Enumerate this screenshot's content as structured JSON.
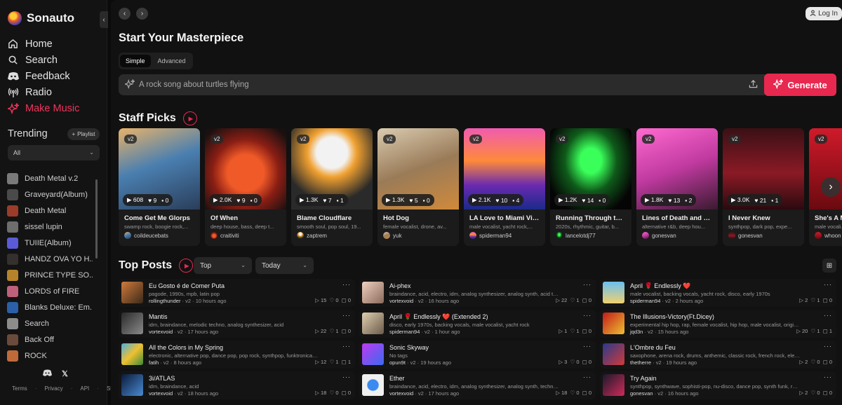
{
  "app": {
    "name": "Sonauto"
  },
  "nav": [
    {
      "label": "Home",
      "icon": "home-icon"
    },
    {
      "label": "Search",
      "icon": "search-icon"
    },
    {
      "label": "Feedback",
      "icon": "discord-icon"
    },
    {
      "label": "Radio",
      "icon": "radio-icon"
    },
    {
      "label": "Make Music",
      "icon": "sparkle-icon",
      "active": true
    }
  ],
  "trending": {
    "title": "Trending",
    "playlist_button": "Playlist",
    "filter": "All",
    "items": [
      {
        "label": "Death Metal v.2",
        "color": "#7a7a7a"
      },
      {
        "label": "Graveyard(Album)",
        "color": "#4a4a4a"
      },
      {
        "label": "Death Metal",
        "color": "#9b3b2a"
      },
      {
        "label": "sissel lupin",
        "color": "#6d6d6d"
      },
      {
        "label": "TUIIE(Album)",
        "color": "#5b5bd8"
      },
      {
        "label": "HANDZ OVA YO H...",
        "color": "#33302d"
      },
      {
        "label": "PRINCE TYPE SO...",
        "color": "#b5842a"
      },
      {
        "label": "LORDS of FIRE",
        "color": "#c0607a"
      },
      {
        "label": "Blanks Deluxe: Em...",
        "color": "#2b5fa8"
      },
      {
        "label": "Search",
        "color": "#8c8c8c"
      },
      {
        "label": "Back Off",
        "color": "#6a4a3a"
      },
      {
        "label": "ROCK",
        "color": "#c06a3a"
      }
    ]
  },
  "footer": {
    "links": [
      "Terms",
      "Privacy",
      "API",
      "Status"
    ]
  },
  "header": {
    "login": "Log In"
  },
  "create": {
    "title": "Start Your Masterpiece",
    "tabs": [
      "Simple",
      "Advanced"
    ],
    "prompt_placeholder": "A rock song about turtles flying",
    "generate": "Generate"
  },
  "staff_picks": {
    "title": "Staff Picks",
    "cards": [
      {
        "version": "v2",
        "plays": "608",
        "likes": "9",
        "comments": "0",
        "title": "Come Get Me Glorps",
        "tags": "swamp rock, boogie rock,...",
        "user": "coildeucebats",
        "art": "linear-gradient(160deg,#e8b36a 0%,#4a7fb0 45%,#2a3d5a 100%)"
      },
      {
        "version": "v2",
        "plays": "2.0K",
        "likes": "9",
        "comments": "0",
        "title": "Of When",
        "tags": "deep house, bass, deep t...",
        "user": "craitiviti",
        "art": "radial-gradient(circle at 50% 55%,#f05a28 0 30%,#8a1e14 55%,#1a1010 90%)"
      },
      {
        "version": "v2",
        "plays": "1.3K",
        "likes": "7",
        "comments": "1",
        "title": "Blame Cloudflare",
        "tags": "smooth soul, pop soul, 19...",
        "user": "zaptrem",
        "art": "radial-gradient(circle at 50% 30%,#f2f2f2 0 22%,#f0a030 35%,#2a2a2a 70%)"
      },
      {
        "version": "v2",
        "plays": "1.3K",
        "likes": "5",
        "comments": "0",
        "title": "Hot Dog",
        "tags": "female vocalist, drone, av...",
        "user": "yuk",
        "art": "linear-gradient(160deg,#d9cbb0 0%,#9a7b58 50%,#d08a3a 100%)"
      },
      {
        "version": "v2",
        "plays": "2.1K",
        "likes": "10",
        "comments": "4",
        "title": "LA Love to Miami Vic...",
        "tags": "male vocalist, yacht rock,...",
        "user": "spiderman94",
        "art": "linear-gradient(180deg,#f05bb0 0%,#ff8a3a 40%,#6a2ab0 70%,#1a2a8a 100%)"
      },
      {
        "version": "v2",
        "plays": "1.2K",
        "likes": "14",
        "comments": "0",
        "title": "Running Through the...",
        "tags": "2020s, rhythmic, guitar, b...",
        "user": "lancelotdj77",
        "art": "radial-gradient(ellipse at 50% 40%,#3aff5a 0 18%,#0f5a1a 45%,#050505 80%)"
      },
      {
        "version": "v2",
        "plays": "1.8K",
        "likes": "13",
        "comments": "2",
        "title": "Lines of Death and Pl...",
        "tags": "alternative r&b, deep hou...",
        "user": "gonesvan",
        "art": "linear-gradient(160deg,#ff6ad0 0%,#c03aa0 50%,#3a1a30 100%)"
      },
      {
        "version": "v2",
        "plays": "3.0K",
        "likes": "21",
        "comments": "1",
        "title": "I Never Knew",
        "tags": "synthpop, dark pop, expe...",
        "user": "gonesvan",
        "art": "linear-gradient(180deg,#3a1015 0%,#8a1a25 55%,#2a0a0f 100%)"
      },
      {
        "version": "v2",
        "plays": "",
        "likes": "",
        "comments": "",
        "title": "She's A M...",
        "tags": "male vocali...",
        "user": "whoon",
        "art": "linear-gradient(180deg,#d01a2a 0%,#6a0a10 100%)"
      }
    ]
  },
  "top_posts": {
    "title": "Top Posts",
    "sort": "Top",
    "period": "Today",
    "posts": [
      {
        "title": "Eu Gosto é de Comer Puta",
        "tags": "pagode, 1990s, mpb, latin pop",
        "user": "rollingthunder",
        "meta": "· v2 · 10 hours ago",
        "plays": "15",
        "likes": "0",
        "comments": "0",
        "thumb": "linear-gradient(135deg,#d07a3a,#3a2a1a)"
      },
      {
        "title": "Mantis",
        "tags": "idm, braindance, melodic techno, analog synthesizer, acid",
        "user": "vortexvoid",
        "meta": "· v2 · 17 hours ago",
        "plays": "22",
        "likes": "1",
        "comments": "0",
        "thumb": "linear-gradient(135deg,#2a2a2a,#8a8a8a)"
      },
      {
        "title": "All the Colors in My Spring",
        "tags": "electronic, alternative pop, dance pop, pop rock, synthpop, funktronica, 2020s,...",
        "user": "fatih",
        "meta": "· v2 · 8 hours ago",
        "plays": "12",
        "likes": "1",
        "comments": "1",
        "thumb": "linear-gradient(135deg,#4ab0e0,#f0c030,#3a8a3a)"
      },
      {
        "title": "3i/ATLAS",
        "tags": "idm, braindance, acid",
        "user": "vortexvoid",
        "meta": "· v2 · 18 hours ago",
        "plays": "18",
        "likes": "0",
        "comments": "0",
        "thumb": "linear-gradient(135deg,#0a1a3a,#4a8ad0)"
      },
      {
        "title": "Ai-phex",
        "tags": "braindance, acid, electro, idm, analog synthesizer, analog synth, acid techno, ...",
        "user": "vortexvoid",
        "meta": "· v2 · 16 hours ago",
        "plays": "22",
        "likes": "1",
        "comments": "0",
        "thumb": "linear-gradient(135deg,#f0d0c0,#8a6a5a)"
      },
      {
        "title": "April 🌹 Endlessly ❤️ (Extended 2)",
        "tags": "disco, early 1970s, backing vocals, male vocalist, yacht rock",
        "user": "spiderman94",
        "meta": "· v2 · 1 hour ago",
        "plays": "1",
        "likes": "1",
        "comments": "0",
        "thumb": "linear-gradient(135deg,#e0d0b0,#6a5a4a)"
      },
      {
        "title": "Sonic Skyway",
        "tags": "No tags",
        "user": "opun9t",
        "meta": "· v2 · 19 hours ago",
        "plays": "3",
        "likes": "0",
        "comments": "0",
        "thumb": "linear-gradient(135deg,#c03af0,#3a6af0)"
      },
      {
        "title": "Ether",
        "tags": "braindance, acid, electro, idm, analog synthesizer, analog synth, techno, acid t...",
        "user": "vortexvoid",
        "meta": "· v2 · 17 hours ago",
        "plays": "18",
        "likes": "0",
        "comments": "0",
        "thumb": "radial-gradient(circle,#3a8af0 0 35%,#f0f0f0 40%)"
      },
      {
        "title": "April 🌹 Endlessly ❤️",
        "tags": "male vocalist, backing vocals, yacht rock, disco, early 1970s",
        "user": "spiderman94",
        "meta": "· v2 · 2 hours ago",
        "plays": "2",
        "likes": "1",
        "comments": "0",
        "thumb": "linear-gradient(180deg,#6ac0f0,#f0d070)"
      },
      {
        "title": "The Illusions-Victory(Ft.Dicey)",
        "tags": "experimental hip hop, rap, female vocalist, hip hop, male vocalist, original soun...",
        "user": "jqd3n",
        "meta": "· v2 · 15 hours ago",
        "plays": "20",
        "likes": "1",
        "comments": "1",
        "thumb": "linear-gradient(135deg,#c01a1a,#f0c030)"
      },
      {
        "title": "L'Ombre du Feu",
        "tags": "saxophone, arena rock, drums, anthemic, classic rock, french rock, electric gui...",
        "user": "thetherre",
        "meta": "· v2 · 19 hours ago",
        "plays": "2",
        "likes": "0",
        "comments": "0",
        "thumb": "linear-gradient(135deg,#2a3a8a,#d03a3a)"
      },
      {
        "title": "Try Again",
        "tags": "synthpop, synthwave, sophisti-pop, nu-disco, dance pop, synth funk, rhythmic...",
        "user": "gonesvan",
        "meta": "· v2 · 16 hours ago",
        "plays": "2",
        "likes": "0",
        "comments": "0",
        "thumb": "linear-gradient(135deg,#1a1a2a,#d02a5a)"
      }
    ]
  },
  "colors": {
    "accent": "#e8284f",
    "background": "#111111",
    "sidebar": "#131313"
  }
}
